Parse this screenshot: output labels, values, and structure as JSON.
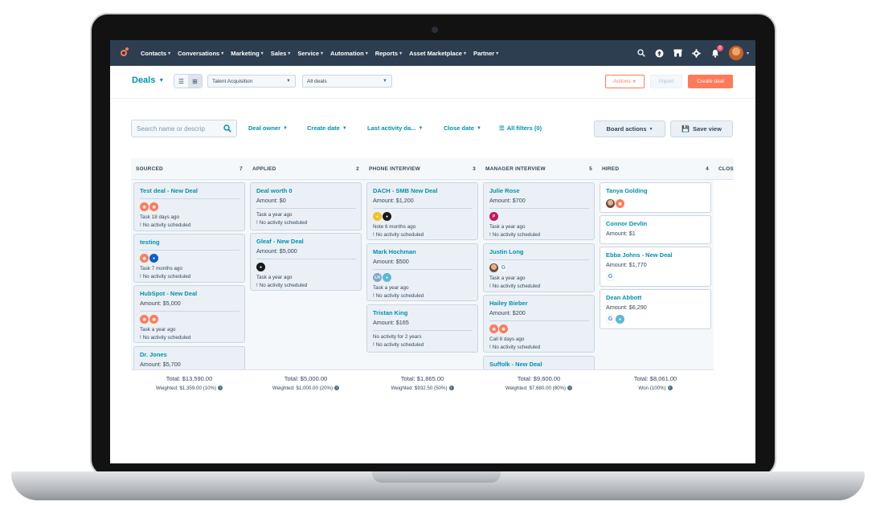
{
  "nav": {
    "items": [
      "Contacts",
      "Conversations",
      "Marketing",
      "Sales",
      "Service",
      "Automation",
      "Reports",
      "Asset Marketplace",
      "Partner"
    ],
    "notification_count": "0"
  },
  "toolbar": {
    "title": "Deals",
    "pipeline_select": "Talent Acquisition",
    "deals_select": "All deals",
    "actions_label": "Actions",
    "import_label": "Import",
    "create_label": "Create deal"
  },
  "filters": {
    "search_placeholder": "Search name or descrip",
    "deal_owner": "Deal owner",
    "create_date": "Create date",
    "last_activity": "Last activity da...",
    "close_date": "Close date",
    "all_filters": "All filters (0)",
    "board_actions": "Board actions",
    "save_view": "Save view"
  },
  "board": {
    "columns": [
      {
        "name": "SOURCED",
        "count": "7",
        "total": "Total: $13,590.00",
        "weighted": "Weighted: $1,359.00 (10%)",
        "cards": [
          {
            "title": "Test deal - New Deal",
            "avatars": [
              "hs",
              "hs"
            ],
            "meta": "Task 18 days ago",
            "sched": "No activity scheduled"
          },
          {
            "title": "testing",
            "avatars": [
              "hs",
              "blue"
            ],
            "meta": "Task 7 months ago",
            "sched": "No activity scheduled"
          },
          {
            "title": "HubSpot - New Deal",
            "amount": "Amount: $5,000",
            "avatars": [
              "hs",
              "hs"
            ],
            "meta": "Task a year ago",
            "sched": "No activity scheduled"
          },
          {
            "title": "Dr. Jones",
            "amount": "Amount: $5,700"
          }
        ]
      },
      {
        "name": "APPLIED",
        "count": "2",
        "total": "Total: $5,000.00",
        "weighted": "Weighted: $1,000.00 (20%)",
        "cards": [
          {
            "title": "Deal worth 0",
            "amount": "Amount: $0",
            "meta": "Task a year ago",
            "sched": "No activity scheduled"
          },
          {
            "title": "Gleaf - New Deal",
            "amount": "Amount: $5,000",
            "avatars": [
              "black"
            ],
            "meta": "Task a year ago",
            "sched": "No activity scheduled"
          }
        ]
      },
      {
        "name": "PHONE INTERVIEW",
        "count": "3",
        "total": "Total: $1,865.00",
        "weighted": "Weighted: $932.50 (50%)",
        "cards": [
          {
            "title": "DACH - SMB New Deal",
            "amount": "Amount: $1,200",
            "avatars": [
              "yellow",
              "black"
            ],
            "meta": "Note 6 months ago",
            "sched": "No activity scheduled"
          },
          {
            "title": "Mark Hochman",
            "amount": "Amount: $500",
            "avatars": [
              "lh",
              "teal"
            ],
            "meta": "Task a year ago",
            "sched": "No activity scheduled"
          },
          {
            "title": "Tristan King",
            "amount": "Amount: $165",
            "meta": "No activity for 2 years",
            "sched": "No activity scheduled"
          }
        ]
      },
      {
        "name": "MANAGER INTERVIEW",
        "count": "5",
        "total": "Total: $9,600.00",
        "weighted": "Weighted: $7,680.00 (80%)",
        "cards": [
          {
            "title": "Julie Rose",
            "amount": "Amount: $700",
            "avatars": [
              "purple"
            ],
            "meta": "Task a year ago",
            "sched": "No activity scheduled"
          },
          {
            "title": "Justin Long",
            "avatars": [
              "face",
              "g"
            ],
            "meta": "Task a year ago",
            "sched": "No activity scheduled"
          },
          {
            "title": "Hailey Bieber",
            "amount": "Amount: $200",
            "avatars": [
              "hs",
              "hs"
            ],
            "meta": "Call 8 days ago",
            "sched": "No activity scheduled"
          },
          {
            "title": "Suffolk - New Deal"
          }
        ]
      },
      {
        "name": "HIRED",
        "count": "4",
        "total": "Total: $8,061.00",
        "weighted": "Won (100%)",
        "cards": [
          {
            "title": "Tanya Golding",
            "avatars": [
              "face",
              "hs"
            ]
          },
          {
            "title": "Connor Devlin",
            "amount": "Amount: $1"
          },
          {
            "title": "Ebba Johns - New Deal",
            "amount": "Amount: $1,770",
            "avatars": [
              "g"
            ]
          },
          {
            "title": "Dean Abbott",
            "amount": "Amount: $6,290",
            "avatars": [
              "g",
              "teal"
            ]
          }
        ]
      },
      {
        "name": "CLOS",
        "count": ""
      }
    ]
  }
}
